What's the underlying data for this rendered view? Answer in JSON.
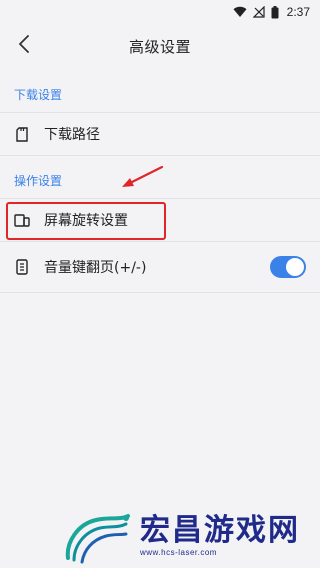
{
  "status_bar": {
    "time": "2:37",
    "icons": [
      "wifi-icon",
      "signal-off-icon",
      "battery-icon"
    ]
  },
  "header": {
    "title": "高级设置",
    "back_icon": "chevron-left-icon"
  },
  "sections": [
    {
      "title": "下载设置",
      "items": [
        {
          "label": "下载路径",
          "icon": "sd-card-icon"
        }
      ]
    },
    {
      "title": "操作设置",
      "items": [
        {
          "label": "屏幕旋转设置",
          "icon": "screen-rotation-icon"
        },
        {
          "label": "音量键翻页(+/-)",
          "icon": "phone-volume-icon",
          "toggle": true
        }
      ]
    }
  ],
  "annotation": {
    "highlight_color": "#e0262a"
  },
  "watermark": {
    "title": "宏昌游戏网",
    "url": "www.hcs-laser.com"
  },
  "colors": {
    "accent": "#3b82e8",
    "background": "#f3f3f6",
    "watermark": "#1f2a8a"
  }
}
